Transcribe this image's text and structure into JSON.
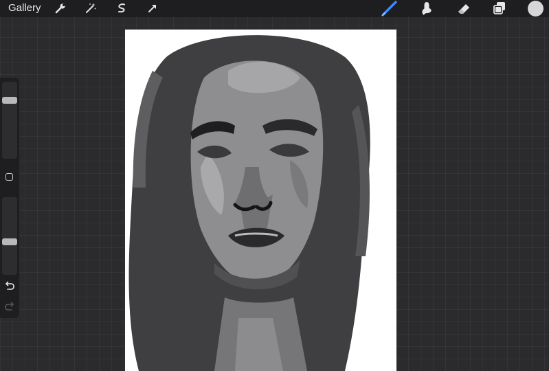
{
  "topbar": {
    "gallery_label": "Gallery",
    "tools_left": [
      "wrench-icon",
      "magic-wand-icon",
      "selection-s-icon",
      "transform-arrow-icon"
    ],
    "tools_right": [
      "brush-icon",
      "smudge-icon",
      "eraser-icon",
      "layers-icon"
    ],
    "current_color": "#d6d6d8",
    "accent_color": "#3d8cff"
  },
  "sidebar": {
    "brush_size_level": 0.78,
    "opacity_level": 0.42
  }
}
